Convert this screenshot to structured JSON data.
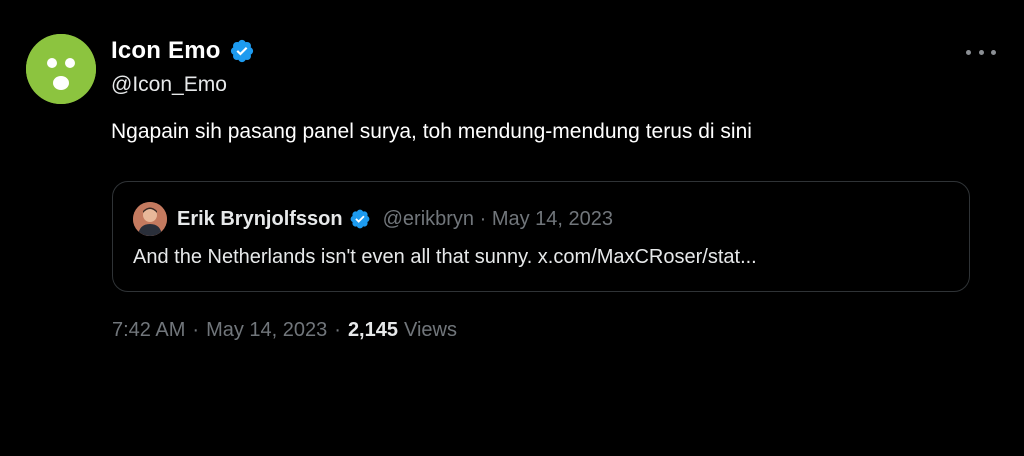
{
  "author": {
    "display_name": "Icon Emo",
    "handle": "@Icon_Emo",
    "avatar_icon": "surprised-face-avatar",
    "avatar_color": "#8cc43f",
    "verified_icon": "verified-badge-icon",
    "verified_color": "#1d9bf0"
  },
  "tweet": {
    "text": "Ngapain sih pasang panel surya, toh mendung-mendung terus di sini",
    "time": "7:42 AM",
    "separator": "·",
    "date": "May 14, 2023",
    "views_count": "2,145",
    "views_label": "Views"
  },
  "quoted_tweet": {
    "display_name": "Erik Brynjolfsson",
    "meta": "@erikbryn · May 14, 2023",
    "text": "And the Netherlands isn't even all that sunny. x.com/MaxCRoser/stat..."
  },
  "more_icon": "more-options-icon",
  "colors": {
    "background": "#000000",
    "primary_text": "#e7e9ea",
    "secondary_text": "#71767b",
    "border": "#2f3336"
  }
}
